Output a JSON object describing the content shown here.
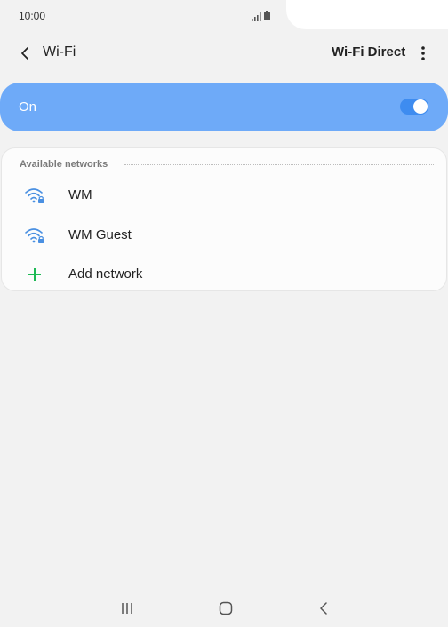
{
  "status_bar": {
    "time": "10:00"
  },
  "header": {
    "title": "Wi-Fi",
    "action": "Wi-Fi Direct"
  },
  "wifi_toggle": {
    "label": "On",
    "state": "on",
    "accent": "#6eaaf8"
  },
  "networks": {
    "section_label": "Available networks",
    "items": [
      {
        "name": "WM",
        "icon": "wifi-locked-icon"
      },
      {
        "name": "WM Guest",
        "icon": "wifi-locked-icon"
      }
    ],
    "add_label": "Add network"
  },
  "colors": {
    "add_icon": "#1db954",
    "wifi_icon": "#4a90e2"
  }
}
